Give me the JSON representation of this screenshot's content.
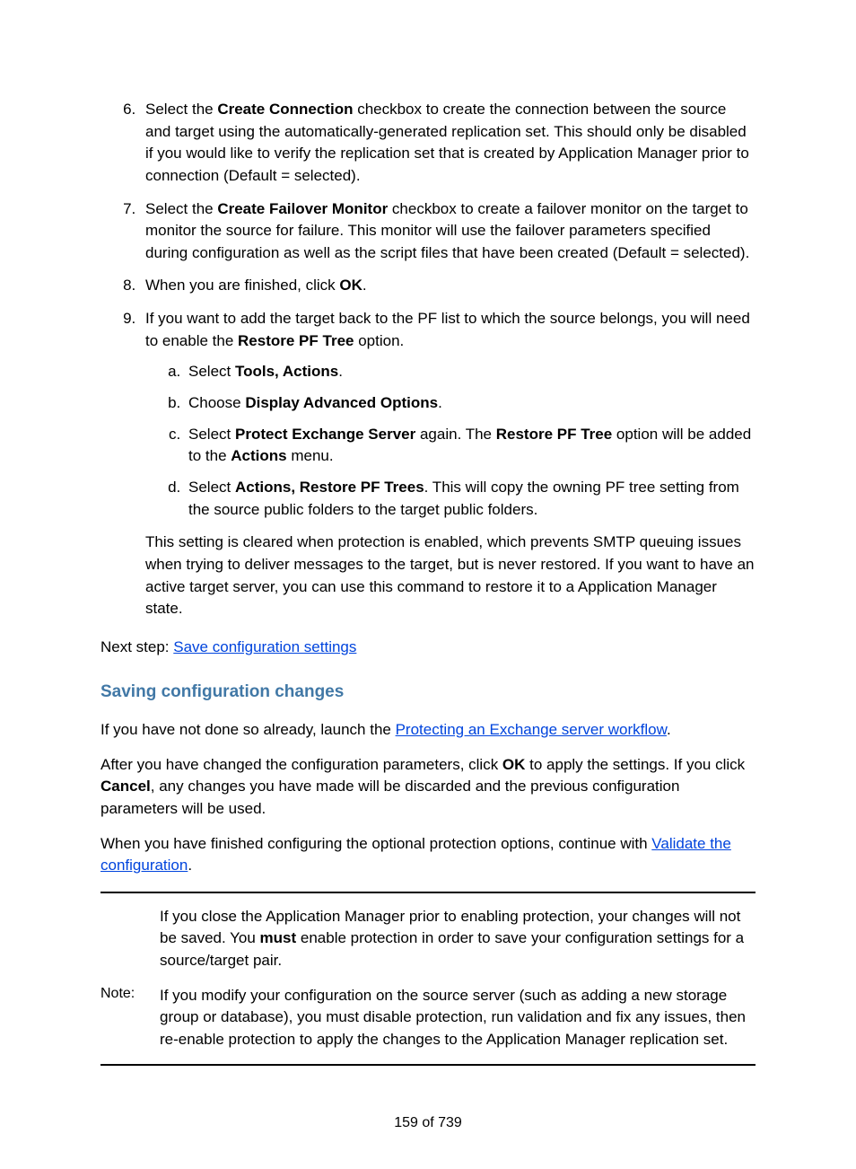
{
  "steps": {
    "s6_a": "Select the ",
    "s6_b": "Create Connection",
    "s6_c": " checkbox to create the connection between the source and target using the automatically-generated replication set. This should only be disabled if you would like to verify the replication set that is created by Application Manager prior to connection (Default = selected).",
    "s7_a": "Select the ",
    "s7_b": "Create Failover Monitor",
    "s7_c": " checkbox to create a failover monitor on the target to monitor the source for failure. This monitor will use the failover parameters specified during configuration as well as the script files that have been created (Default = selected).",
    "s8_a": "When you are finished, click ",
    "s8_b": "OK",
    "s8_c": ".",
    "s9_a": "If you want to add the target back to the PF list to which the source belongs, you will need to enable the ",
    "s9_b": "Restore PF Tree",
    "s9_c": " option.",
    "sa_a": "Select ",
    "sa_b": "Tools, Actions",
    "sa_c": ".",
    "sb_a": "Choose ",
    "sb_b": "Display Advanced Options",
    "sb_c": ".",
    "sc_a": "Select ",
    "sc_b": "Protect Exchange Server",
    "sc_c": " again. The ",
    "sc_d": "Restore PF Tree",
    "sc_e": " option will be added to the ",
    "sc_f": "Actions",
    "sc_g": " menu.",
    "sd_a": "Select ",
    "sd_b": "Actions, Restore PF Trees",
    "sd_c": ". This will copy the owning PF tree setting from the source public folders to the target public folders.",
    "s9_after": "This setting is cleared when protection is enabled, which prevents SMTP queuing issues when trying to deliver messages to the target, but is never restored. If you want to have an active target server, you can use this command to restore it to a Application Manager state."
  },
  "next_step_label": "Next step: ",
  "next_step_link": "Save configuration settings",
  "heading": "Saving configuration changes",
  "para1_a": "If you have not done so already, launch the ",
  "para1_link": "Protecting an Exchange server workflow",
  "para1_b": ".",
  "para2_a": "After you have changed the configuration parameters, click ",
  "para2_b": "OK",
  "para2_c": " to apply the settings. If you click ",
  "para2_d": "Cancel",
  "para2_e": ", any changes you have made will be discarded and the previous configuration parameters will be used.",
  "para3_a": "When you have finished configuring the optional protection options, continue with ",
  "para3_link": "Validate the configuration",
  "para3_b": ".",
  "note_label": "Note:",
  "note_p1_a": "If you close the Application Manager prior to enabling protection, your changes will not be saved. You ",
  "note_p1_b": "must",
  "note_p1_c": " enable protection in order to save your configuration settings for a source/target pair.",
  "note_p2": "If you modify your configuration on the source server (such as adding a new storage group or database), you must disable protection, run validation and fix any issues, then re-enable protection to apply the changes to the Application Manager replication set.",
  "page_footer": "159 of 739"
}
